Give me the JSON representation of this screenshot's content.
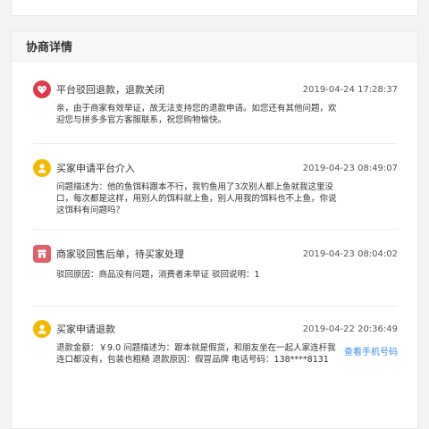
{
  "panel": {
    "title": "协商详情"
  },
  "entries": [
    {
      "role": "platform",
      "title": "平台驳回退款，退款关闭",
      "time": "2019-04-24 17:28:37",
      "body_lines": [
        "亲，由于商家有效举证，故无法支持您的退款申请。如您还有其他问题，欢",
        "迎您与拼多多官方客服联系，祝您购物愉快。"
      ]
    },
    {
      "role": "buyer",
      "title": "买家申请平台介入",
      "time": "2019-04-23 08:49:07",
      "body_lines": [
        "问题描述为：他的鱼饵料跟本不行，我钓鱼用了3次别人都上鱼就我这里没",
        "口，每次都是这样，用别人的饵料就上鱼，别人用我的饵料也不上鱼，你说",
        "这饵料有问题吗？"
      ]
    },
    {
      "role": "merchant",
      "title": "商家驳回售后单，待买家处理",
      "time": "2019-04-23 08:04:02",
      "body_lines": [
        "驳回原因：商品没有问题，消费者未举证  驳回说明：1"
      ]
    },
    {
      "role": "buyer",
      "title": "买家申请退款",
      "time": "2019-04-22 20:36:49",
      "body_lines": [
        "退款金额：￥9.0  问题描述为：跟本就是假货，和朋友坐在一起人家连杆我",
        "连口都没有，包装也粗糙  退款原因：假冒品牌  电话号码：138****8131"
      ],
      "link": "查看手机号码"
    }
  ],
  "colors": {
    "link": "#3a8ee6",
    "platform_avatar": "#e03a4a",
    "buyer_avatar": "#f5b800",
    "merchant_avatar": "#e0606a"
  },
  "icons": {
    "platform": "platform-logo-icon",
    "buyer": "user-avatar-icon",
    "merchant": "store-icon"
  }
}
